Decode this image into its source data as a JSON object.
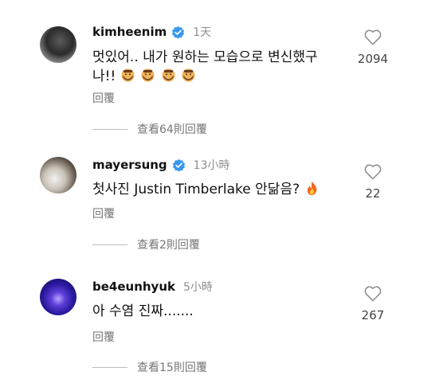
{
  "comments": [
    {
      "username": "kimheenim",
      "verified": true,
      "time": "1天",
      "text_line1": "멋있어.. 내가 원하는 모습으로 변신했구",
      "text_line2": "나!!",
      "emoji_count": 4,
      "reply_label": "回覆",
      "likes": "2094",
      "view_replies": "查看64則回覆"
    },
    {
      "username": "mayersung",
      "verified": true,
      "time": "13小時",
      "text_line1": "첫사진 Justin Timberlake 안닮음?",
      "reply_label": "回覆",
      "likes": "22",
      "view_replies": "查看2則回覆"
    },
    {
      "username": "be4eunhyuk",
      "verified": false,
      "time": "5小時",
      "text_line1": "아 수염 진짜.......",
      "reply_label": "回覆",
      "likes": "267",
      "view_replies": "查看15則回覆"
    }
  ]
}
